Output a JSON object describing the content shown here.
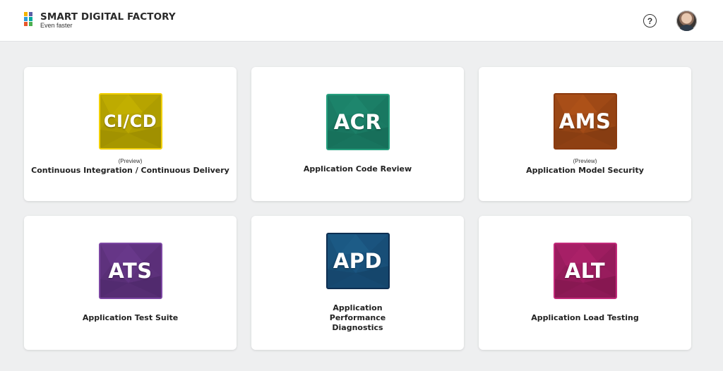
{
  "header": {
    "brand_title": "SMART DIGITAL FACTORY",
    "brand_tagline": "Even faster",
    "help_label": "?",
    "logo_colors": [
      "#f4b400",
      "#2e9bd6",
      "#e8572a",
      "#5b5ea6",
      "#00a99d",
      "#4caf50"
    ]
  },
  "cards": [
    {
      "abbr": "CI/CD",
      "preview": "(Preview)",
      "title": "Continuous Integration / Continuous Delivery",
      "color": "#c8b400",
      "border": "#f2d000",
      "dark": "#6a6000",
      "icon": "cicd-tile-icon"
    },
    {
      "abbr": "ACR",
      "preview": "",
      "title": "Application Code Review",
      "color": "#1f8a70",
      "border": "#27a07f",
      "dark": "#0c4a3c",
      "icon": "acr-tile-icon"
    },
    {
      "abbr": "AMS",
      "preview": "(Preview)",
      "title": "Application Model Security",
      "color": "#b3541a",
      "border": "#8c3a0f",
      "dark": "#4a1e08",
      "icon": "ams-tile-icon"
    },
    {
      "abbr": "ATS",
      "preview": "",
      "title": "Application Test Suite",
      "color": "#6c3a8f",
      "border": "#7d47a3",
      "dark": "#2e1640",
      "icon": "ats-tile-icon"
    },
    {
      "abbr": "APD",
      "preview": "",
      "title": "Application Performance Diagnostics",
      "color": "#1e5f8c",
      "border": "#0e2f52",
      "dark": "#0a2340",
      "icon": "apd-tile-icon"
    },
    {
      "abbr": "ALT",
      "preview": "",
      "title": "Application Load Testing",
      "color": "#b0226c",
      "border": "#c22a7a",
      "dark": "#4e0a2e",
      "icon": "alt-tile-icon"
    }
  ]
}
